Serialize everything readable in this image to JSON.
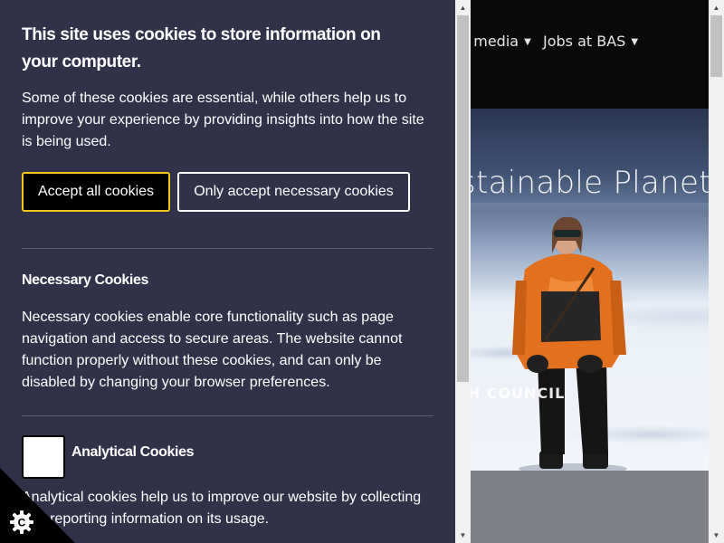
{
  "site": {
    "nav": [
      {
        "label": "d media"
      },
      {
        "label": "Jobs at BAS"
      }
    ],
    "hero_title": "stainable Planet",
    "hero_council": "CH COUNCIL"
  },
  "cookie_panel": {
    "heading": "This site uses cookies to store information on your computer.",
    "intro": "Some of these cookies are essential, while others help us to improve your experience by providing insights into how the site is being used.",
    "accept_all_label": "Accept all cookies",
    "necessary_only_label": "Only accept necessary cookies",
    "necessary": {
      "title": "Necessary Cookies",
      "text": "Necessary cookies enable core functionality such as page navigation and access to secure areas. The website cannot function properly without these cookies, and can only be disabled by changing your browser preferences."
    },
    "analytical": {
      "title": "Analytical Cookies",
      "text": "Analytical cookies help us to improve our website by collecting and reporting information on its usage.",
      "checked": false
    },
    "corner_icon": "cookie-gear-icon"
  },
  "colors": {
    "panel_bg": "#31314a",
    "accept_border": "#f5c518",
    "nav_bg": "#0a0a0a"
  }
}
